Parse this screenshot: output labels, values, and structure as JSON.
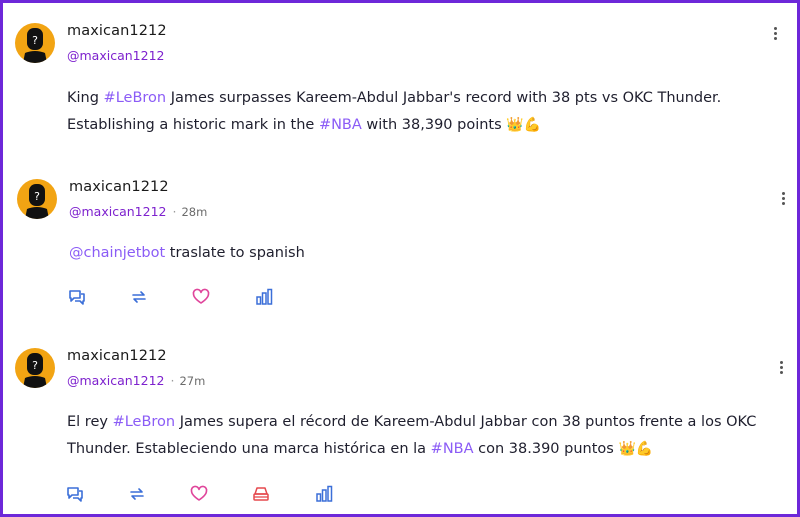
{
  "posts": [
    {
      "username": "maxican1212",
      "handle": "@maxican1212",
      "time": "",
      "text": {
        "line1_a": "King ",
        "tag_lebron": "#LeBron",
        "line1_b": " James surpasses Kareem-Abdul Jabbar's record with 38 pts vs OKC Thunder.",
        "line2_a": "Establishing a historic mark in the ",
        "tag_nba": "#NBA",
        "line2_b": " with 38,390 points ",
        "emoji": "👑💪"
      }
    },
    {
      "username": "maxican1212",
      "handle": "@maxican1212",
      "separator": "·",
      "time": "28m",
      "text": {
        "mention": "@chainjetbot",
        "rest": " traslate to spanish"
      }
    },
    {
      "username": "maxican1212",
      "handle": "@maxican1212",
      "separator": "·",
      "time": "27m",
      "text": {
        "line1_a": "El rey ",
        "tag_lebron": "#LeBron",
        "line1_b": " James supera el récord de Kareem-Abdul Jabbar con 38 puntos frente a los OKC",
        "line2_a": "Thunder. Estableciendo una marca histórica en la ",
        "tag_nba": "#NBA",
        "line2_b": " con 38.390 puntos ",
        "emoji": "👑💪"
      }
    }
  ],
  "colors": {
    "frame": "#6d28d9",
    "accent": "#8b5cf6",
    "handle": "#7e22ce",
    "avatar": "#f2a413",
    "icon": "#3b6fd8",
    "heart": "#e0459b",
    "mint": "#e5484d"
  },
  "icons": [
    "more-vertical-icon",
    "comment-icon",
    "repost-icon",
    "heart-icon",
    "mint-icon",
    "stats-icon"
  ]
}
